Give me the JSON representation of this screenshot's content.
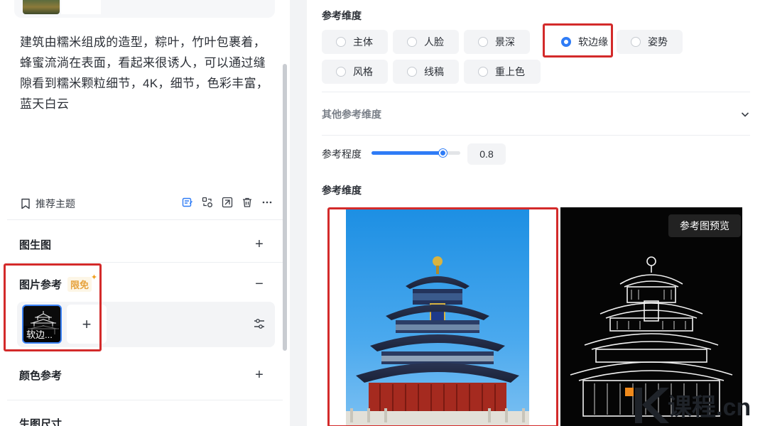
{
  "left_panel": {
    "prompt_text": "建筑由糯米组成的造型，粽叶，竹叶包裹着，蜂蜜流淌在表面，看起来很诱人，可以通过缝隙看到糯米颗粒细节，4K，细节，色彩丰富，蓝天白云",
    "recommend_label": "推荐主题",
    "toolbar_icons": [
      "edit-note-icon",
      "swap-icon",
      "expand-icon",
      "trash-icon",
      "more-icon"
    ],
    "sections": {
      "img2img": {
        "title": "图生图",
        "action": "+"
      },
      "image_ref": {
        "title": "图片参考",
        "badge": "限免",
        "badge_star": "✦",
        "action": "−",
        "thumb_label": "软边...",
        "add_label": "+"
      },
      "color_ref": {
        "title": "颜色参考",
        "action": "+"
      },
      "size": {
        "title": "生图尺寸"
      }
    }
  },
  "right_panel": {
    "dimension_label": "参考维度",
    "options": [
      {
        "label": "主体",
        "selected": false
      },
      {
        "label": "人脸",
        "selected": false
      },
      {
        "label": "景深",
        "selected": false
      },
      {
        "label": "软边缘",
        "selected": true
      },
      {
        "label": "姿势",
        "selected": false
      },
      {
        "label": "风格",
        "selected": false
      },
      {
        "label": "线稿",
        "selected": false
      },
      {
        "label": "重上色",
        "selected": false
      }
    ],
    "other_dimension_label": "其他参考维度",
    "strength_label": "参考程度",
    "strength_value": "0.8",
    "strength_fraction": 0.8,
    "dimension_label_2": "参考维度",
    "preview_button": "参考图预览",
    "watermark_text": "课程.cn"
  },
  "colors": {
    "accent": "#2f7cf6",
    "highlight": "#d32a2a",
    "badge": "#e6a23c"
  }
}
